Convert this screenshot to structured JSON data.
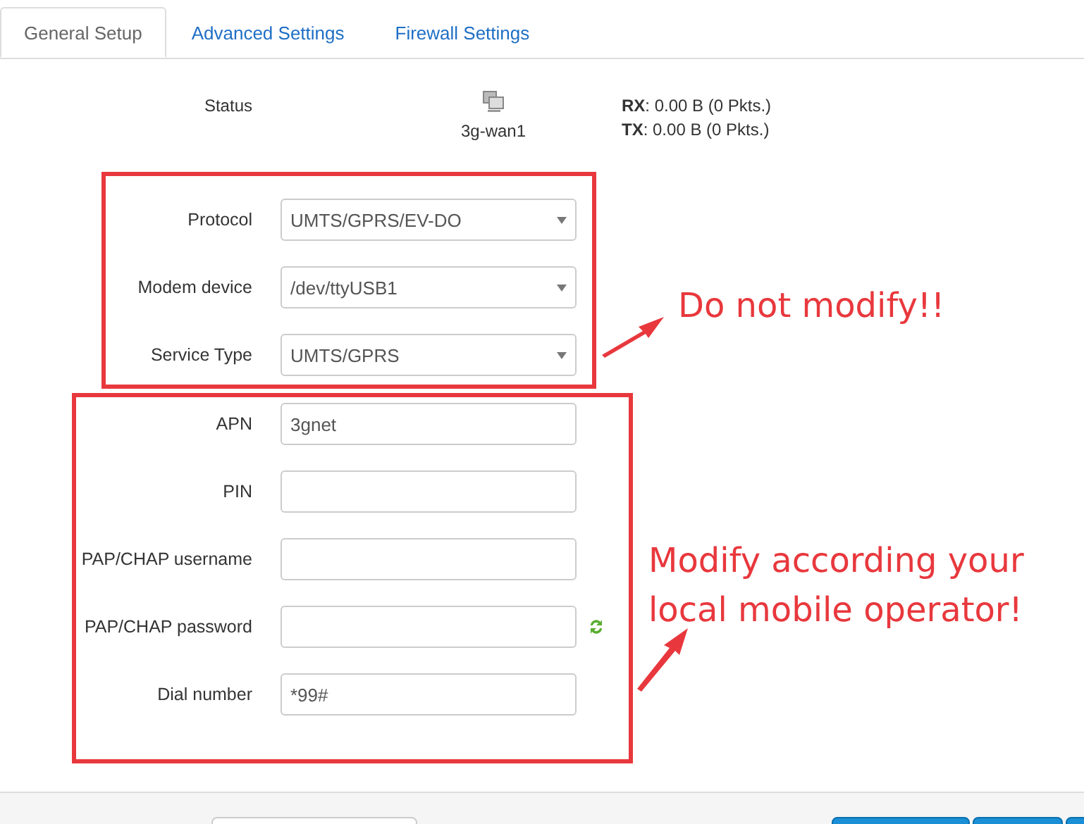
{
  "tabs": [
    {
      "label": "General Setup",
      "selected": true
    },
    {
      "label": "Advanced Settings",
      "selected": false
    },
    {
      "label": "Firewall Settings",
      "selected": false
    }
  ],
  "status": {
    "label": "Status",
    "device": "3g-wan1",
    "lines": [
      "**RX**: 0.00 B (0 Pkts.)",
      "**TX**: 0.00 B (0 Pkts.)"
    ]
  },
  "groups": [
    {
      "fields": [
        {
          "label": "Protocol",
          "kind": "select",
          "value": "UMTS/GPRS/EV-DO"
        },
        {
          "label": "Modem device",
          "kind": "select",
          "value": "/dev/ttyUSB1"
        },
        {
          "label": "Service Type",
          "kind": "select",
          "value": "UMTS/GPRS"
        }
      ]
    },
    {
      "fields": [
        {
          "label": "APN",
          "kind": "text",
          "value": "3gnet"
        },
        {
          "label": "PIN",
          "kind": "text"
        },
        {
          "label": "PAP/CHAP username",
          "kind": "text"
        },
        {
          "label": "PAP/CHAP password",
          "kind": "password"
        },
        {
          "label": "Dial number",
          "kind": "text",
          "value": "*99#"
        }
      ]
    }
  ],
  "annotations": [
    "Do not modify!!",
    "Modify according your\nlocal mobile operator!"
  ]
}
